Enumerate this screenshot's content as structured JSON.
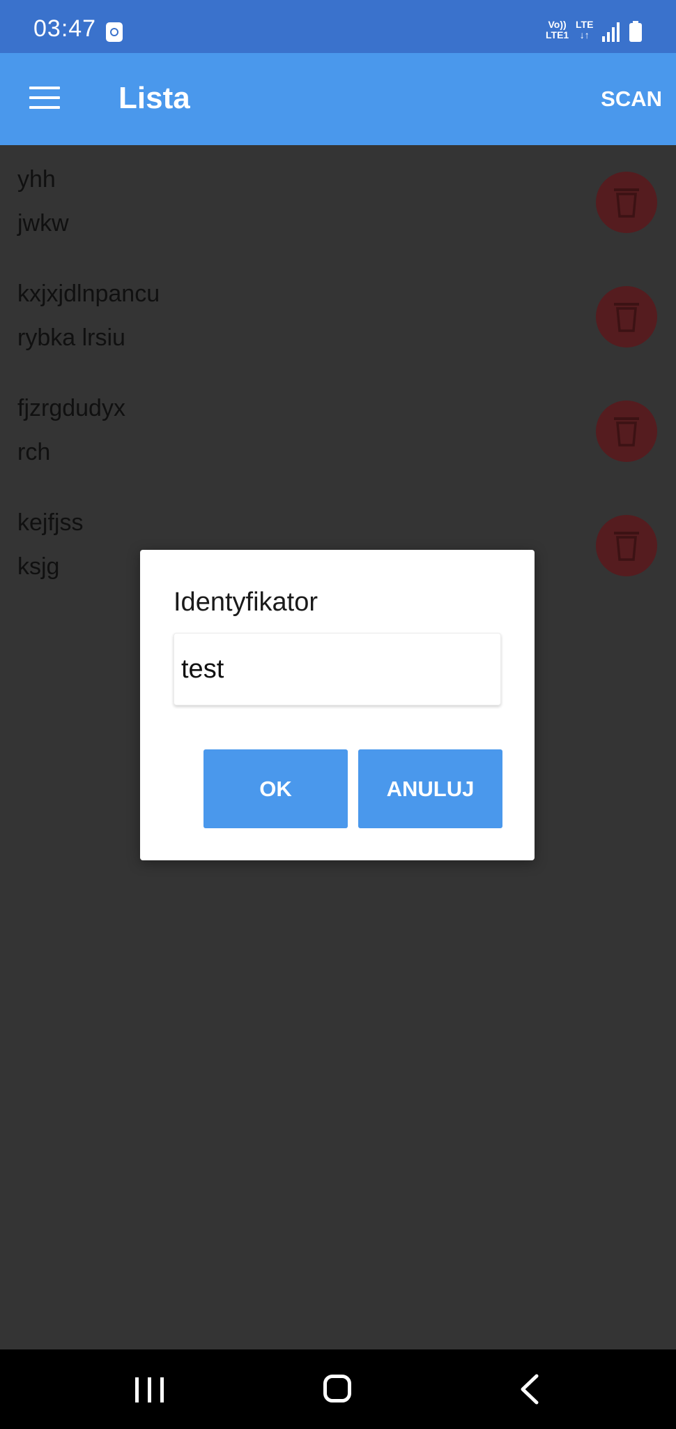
{
  "status_bar": {
    "time": "03:47",
    "volte_top": "Vo))",
    "volte_bottom": "LTE1",
    "lte_top": "LTE",
    "lte_bottom": "↓↑"
  },
  "app_bar": {
    "title": "Lista",
    "action": "SCAN"
  },
  "list": {
    "items": [
      {
        "line1": "yhh",
        "line2": "jwkw"
      },
      {
        "line1": "kxjxjdlnpancu",
        "line2": "rybka lrsiu"
      },
      {
        "line1": "fjzrgdudyx",
        "line2": "rch"
      },
      {
        "line1": "kejfjss",
        "line2": "ksjg"
      }
    ]
  },
  "dialog": {
    "title": "Identyfikator",
    "input_value": "test",
    "ok_label": "OK",
    "cancel_label": "ANULUJ"
  },
  "colors": {
    "status_bar": "#3a72cc",
    "app_bar": "#4a98ec",
    "background": "#343434",
    "delete_button": "#551c1f",
    "dialog_button": "#4a98ec"
  },
  "icons": [
    "menu-icon",
    "trash-icon",
    "recents-icon",
    "home-icon",
    "back-icon"
  ]
}
